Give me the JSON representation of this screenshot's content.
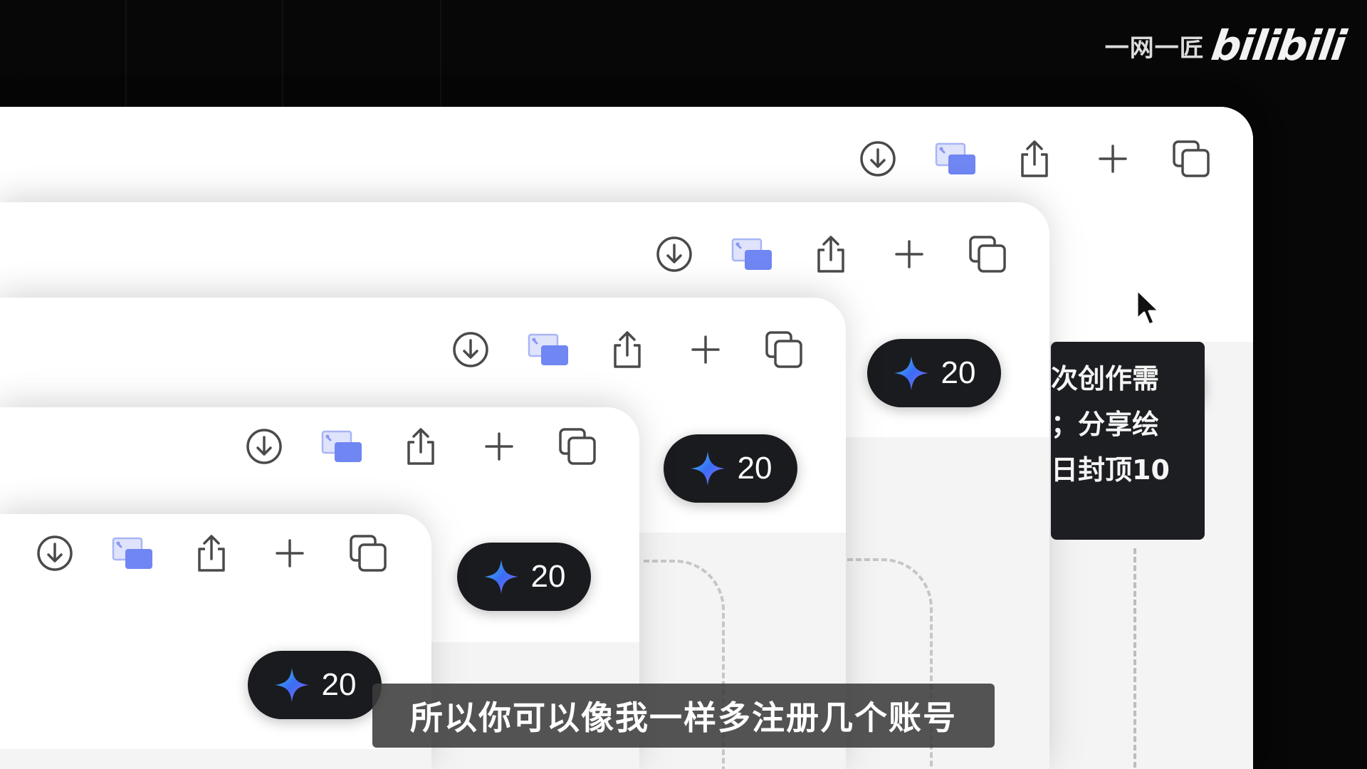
{
  "watermark": {
    "user": "一网一匠",
    "logo": "bilibili"
  },
  "cards": [
    {
      "credits": "20"
    },
    {
      "credits": "20"
    },
    {
      "credits": "20"
    },
    {
      "credits": "20"
    },
    {
      "credits": "20"
    }
  ],
  "toolbar_icons": [
    "download-icon",
    "image-compare-icon",
    "share-icon",
    "plus-icon",
    "copy-icon"
  ],
  "accent_colors": {
    "sparkle_blue": "#3b6cf6",
    "sparkle_cyan": "#37c8e6",
    "sparkle_purple": "#8e6bf0",
    "image_icon": "#6f86f3",
    "pill_bg": "#1a1b1f"
  },
  "tooltip": {
    "lines": [
      "次创作需",
      "；分享绘",
      "日封顶10"
    ]
  },
  "subtitle": "所以你可以像我一样多注册几个账号"
}
